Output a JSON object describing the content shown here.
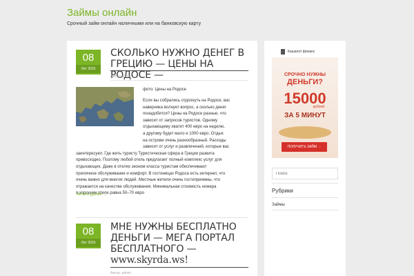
{
  "site": {
    "title": "Займы онлайн",
    "description": "Срочный займ онлайн наличными или на банковскую карту"
  },
  "posts": [
    {
      "day": "08",
      "month": "Окт 2015",
      "title": "Сколько нужно денег в Грецию — цены на Родосе —",
      "author": "Автор: admin",
      "image_caption": "фото: Цены на Родосе",
      "body_lines": [
        "Если вы собрались отдохнуть на Родосе, вас",
        "наверняка волнует вопрос, а сколько денег",
        "понадобится? Цены на Родосе разные, что",
        "зависит от запросов туристов. Одному",
        "отдыхающему хватит 400 евро на неделю,",
        "а другому будет мало и 1000 евро. Отдых",
        "на острове очень разнообразный. Расходы",
        "зависят от услуг и развлечений, которые вас",
        "заинтересуют. Где жить туристу Туристическая сфера в Греции развита",
        "превосходно. Поэтому любой отель предлагает полный комплекс услуг для",
        "отдыхающих. Даже в отелях эконом класса туристам обеспечивают",
        "приличное обслуживание и комфорт. В гостиницах Родоса есть интернет, что",
        "очень важно для многих людей. Местные жители очень гостеприимны, что",
        "отражается на качестве обслуживания. Минимальная стоимость номера",
        "в хорошем отеле равна 50–70 евро"
      ],
      "read_more": "Читать далее →"
    },
    {
      "day": "08",
      "month": "Окт 2015",
      "title_line1": "Мне нужны бесплатно",
      "title_line2": "деньги — мега портал",
      "title_line3": "бесплатного —",
      "title_line4": "www.skyrda.ws!",
      "author": "Автор: admin"
    }
  ],
  "sidebar": {
    "widget_label": "Кашалот финанс",
    "banner": {
      "line1": "СРОЧНО НУЖНЫ",
      "line2": "ДЕНЬГИ?",
      "amount": "15000",
      "currency": "рублей",
      "line3": "ЗА 5 МИНУТ",
      "button": "ПОЛУЧИТЬ ЗАЙМ →"
    },
    "search_placeholder": "Поиск",
    "categories_title": "Рубрики",
    "categories": [
      "Займы"
    ]
  },
  "colors": {
    "accent": "#7cb526",
    "background": "#ececec",
    "banner_red": "#d03a2a"
  }
}
